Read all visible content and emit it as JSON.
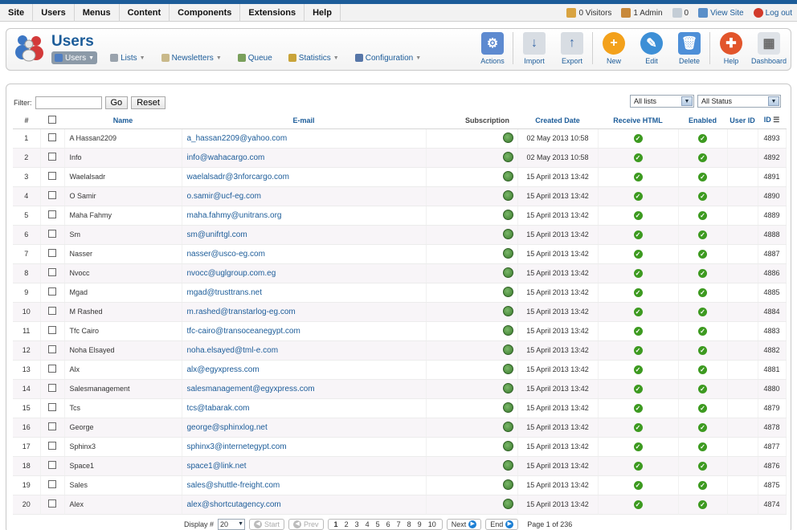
{
  "menubar": {
    "items": [
      "Site",
      "Users",
      "Menus",
      "Content",
      "Components",
      "Extensions",
      "Help"
    ]
  },
  "status": {
    "visitors": "0 Visitors",
    "admins": "1 Admin",
    "messages": "0",
    "view_site": "View Site",
    "logout": "Log out"
  },
  "header": {
    "title": "Users",
    "subnav": [
      {
        "label": "Users",
        "active": true
      },
      {
        "label": "Lists"
      },
      {
        "label": "Newsletters"
      },
      {
        "label": "Queue"
      },
      {
        "label": "Statistics"
      },
      {
        "label": "Configuration"
      }
    ],
    "toolbar": {
      "actions": "Actions",
      "import": "Import",
      "export": "Export",
      "new": "New",
      "edit": "Edit",
      "delete": "Delete",
      "help": "Help",
      "dashboard": "Dashboard"
    }
  },
  "filter": {
    "label": "Filter:",
    "value": "",
    "go": "Go",
    "reset": "Reset",
    "lists_select": "All lists",
    "status_select": "All Status"
  },
  "table": {
    "headers": {
      "num": "#",
      "name": "Name",
      "email": "E-mail",
      "subscription": "Subscription",
      "created": "Created Date",
      "html": "Receive HTML",
      "enabled": "Enabled",
      "userid": "User ID",
      "id": "ID"
    },
    "rows": [
      {
        "num": "1",
        "name": "A Hassan2209",
        "email": "a_hassan2209@yahoo.com",
        "date": "02 May 2013 10:58",
        "id": "4893"
      },
      {
        "num": "2",
        "name": "Info",
        "email": "info@wahacargo.com",
        "date": "02 May 2013 10:58",
        "id": "4892"
      },
      {
        "num": "3",
        "name": "Waelalsadr",
        "email": "waelalsadr@3nforcargo.com",
        "date": "15 April 2013 13:42",
        "id": "4891"
      },
      {
        "num": "4",
        "name": "O Samir",
        "email": "o.samir@ucf-eg.com",
        "date": "15 April 2013 13:42",
        "id": "4890"
      },
      {
        "num": "5",
        "name": "Maha Fahmy",
        "email": "maha.fahmy@unitrans.org",
        "date": "15 April 2013 13:42",
        "id": "4889"
      },
      {
        "num": "6",
        "name": "Sm",
        "email": "sm@unifrtgl.com",
        "date": "15 April 2013 13:42",
        "id": "4888"
      },
      {
        "num": "7",
        "name": "Nasser",
        "email": "nasser@usco-eg.com",
        "date": "15 April 2013 13:42",
        "id": "4887"
      },
      {
        "num": "8",
        "name": "Nvocc",
        "email": "nvocc@uglgroup.com.eg",
        "date": "15 April 2013 13:42",
        "id": "4886"
      },
      {
        "num": "9",
        "name": "Mgad",
        "email": "mgad@trusttrans.net",
        "date": "15 April 2013 13:42",
        "id": "4885"
      },
      {
        "num": "10",
        "name": "M Rashed",
        "email": "m.rashed@transtarlog-eg.com",
        "date": "15 April 2013 13:42",
        "id": "4884"
      },
      {
        "num": "11",
        "name": "Tfc Cairo",
        "email": "tfc-cairo@transoceanegypt.com",
        "date": "15 April 2013 13:42",
        "id": "4883"
      },
      {
        "num": "12",
        "name": "Noha Elsayed",
        "email": "noha.elsayed@tml-e.com",
        "date": "15 April 2013 13:42",
        "id": "4882"
      },
      {
        "num": "13",
        "name": "Alx",
        "email": "alx@egyxpress.com",
        "date": "15 April 2013 13:42",
        "id": "4881"
      },
      {
        "num": "14",
        "name": "Salesmanagement",
        "email": "salesmanagement@egyxpress.com",
        "date": "15 April 2013 13:42",
        "id": "4880"
      },
      {
        "num": "15",
        "name": "Tcs",
        "email": "tcs@tabarak.com",
        "date": "15 April 2013 13:42",
        "id": "4879"
      },
      {
        "num": "16",
        "name": "George",
        "email": "george@sphinxlog.net",
        "date": "15 April 2013 13:42",
        "id": "4878"
      },
      {
        "num": "17",
        "name": "Sphinx3",
        "email": "sphinx3@internetegypt.com",
        "date": "15 April 2013 13:42",
        "id": "4877"
      },
      {
        "num": "18",
        "name": "Space1",
        "email": "space1@link.net",
        "date": "15 April 2013 13:42",
        "id": "4876"
      },
      {
        "num": "19",
        "name": "Sales",
        "email": "sales@shuttle-freight.com",
        "date": "15 April 2013 13:42",
        "id": "4875"
      },
      {
        "num": "20",
        "name": "Alex",
        "email": "alex@shortcutagency.com",
        "date": "15 April 2013 13:42",
        "id": "4874"
      }
    ]
  },
  "pager": {
    "display_label": "Display #",
    "display_value": "20",
    "start": "Start",
    "prev": "Prev",
    "pages": [
      "1",
      "2",
      "3",
      "4",
      "5",
      "6",
      "7",
      "8",
      "9",
      "10"
    ],
    "next": "Next",
    "end": "End",
    "page_info": "Page 1 of 236"
  }
}
